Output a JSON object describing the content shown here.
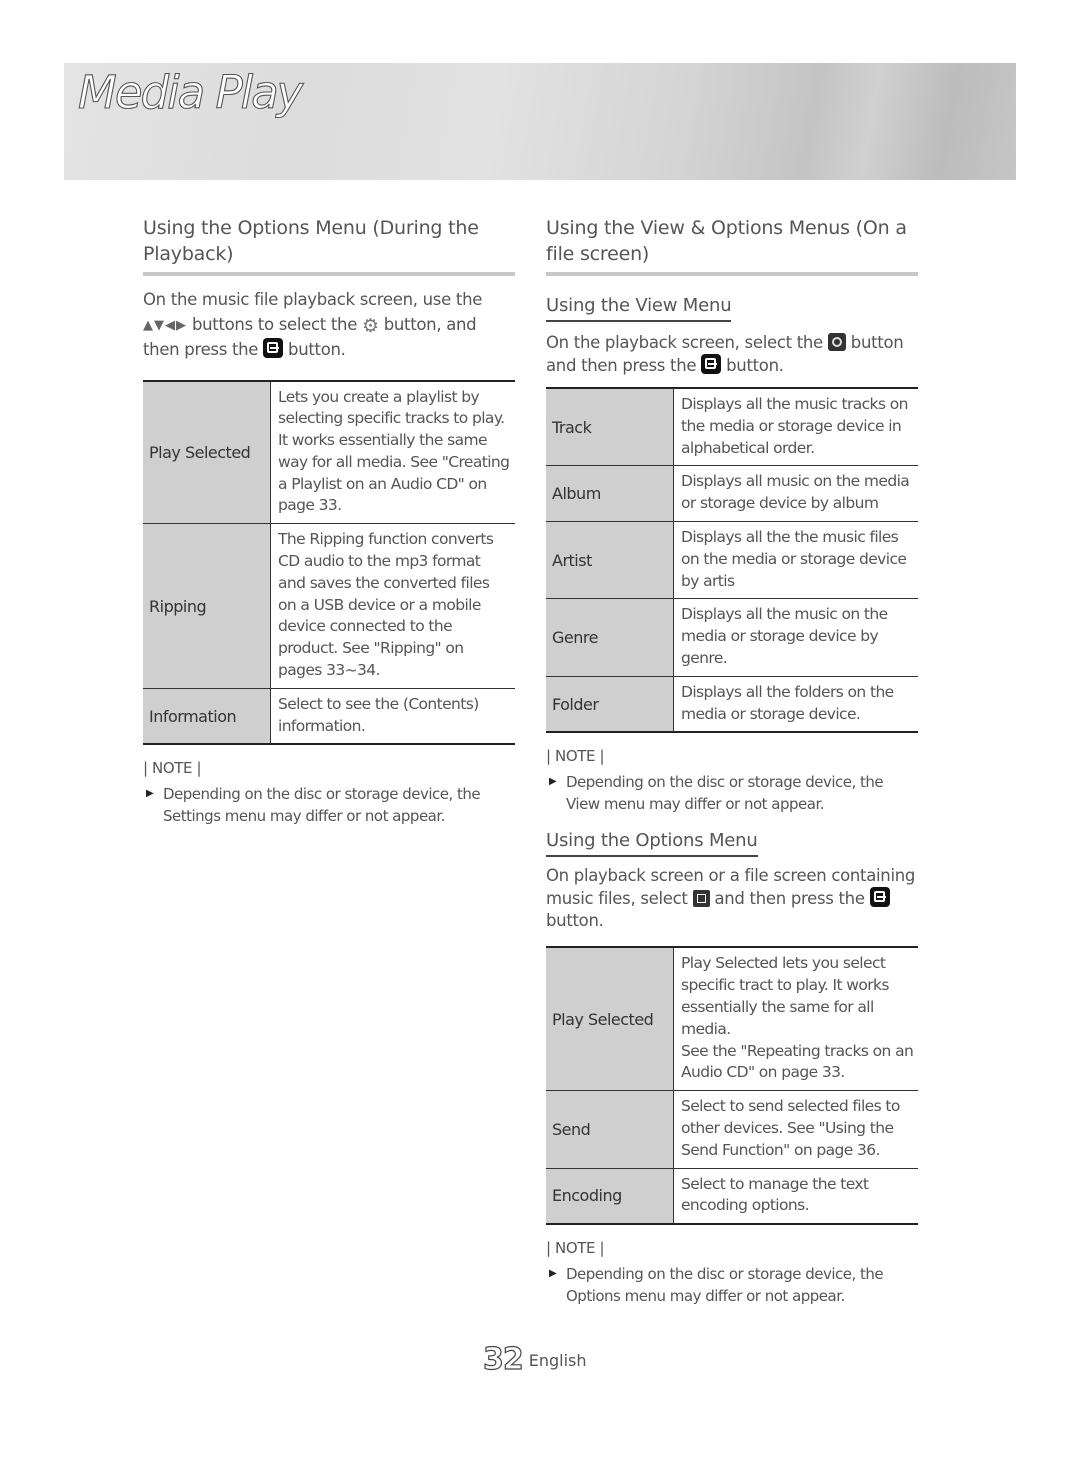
{
  "chapter_title": "Media Play",
  "left": {
    "heading": "Using the Options Menu (During the Playback)",
    "intro": {
      "line1": "On the music file playback screen, use the",
      "arrows": "▲▼◀▶",
      "part2": " buttons to select the ",
      "part3": " button, and",
      "part4": "then press the ",
      "part5": " button."
    },
    "table": [
      {
        "name": "Play Selected",
        "desc": "Lets you create a playlist by selecting specific tracks to play. It works essentially the same way for all media. See \"Creating a Playlist on an Audio CD\" on page 33."
      },
      {
        "name": "Ripping",
        "desc": "The Ripping function converts CD audio to the mp3 format and saves the converted files on a USB device or a mobile device connected to the product. See \"Ripping\" on pages 33~34."
      },
      {
        "name": "Information",
        "desc": "Select to see the (Contents) information."
      }
    ],
    "note_label": "| NOTE |",
    "note": "Depending on the disc or storage device, the Settings menu may differ or not appear."
  },
  "right": {
    "heading": "Using the View & Options Menus (On a file screen)",
    "view": {
      "heading": "Using the View Menu",
      "p1": "On the playback screen, select the ",
      "p2": " button and then press the ",
      "p3": " button.",
      "table": [
        {
          "name": "Track",
          "desc": "Displays all the music tracks on the media or storage device in alphabetical order."
        },
        {
          "name": "Album",
          "desc": "Displays all music on the media or storage device by album"
        },
        {
          "name": "Artist",
          "desc": "Displays all the the music files on the media or storage device by artis"
        },
        {
          "name": "Genre",
          "desc": "Displays all the music on the media or storage device by genre."
        },
        {
          "name": "Folder",
          "desc": "Displays all the folders on the media or storage device."
        }
      ],
      "note_label": "| NOTE |",
      "note": "Depending on the disc or storage device, the View menu may differ or not appear."
    },
    "options": {
      "heading": "Using the Options Menu",
      "p1": "On playback screen or a file screen containing music files, select ",
      "p2": " and then press the ",
      "p3": " button.",
      "table": [
        {
          "name": "Play Selected",
          "desc": "Play Selected lets you select specific tract to play. It works essentially the same for all media.",
          "desc2": "See the \"Repeating tracks on an Audio CD\" on page 33."
        },
        {
          "name": "Send",
          "desc": "Select to send selected files to other devices. See \"Using the Send Function\" on page 36."
        },
        {
          "name": "Encoding",
          "desc": "Select to manage the text encoding options."
        }
      ],
      "note_label": "| NOTE |",
      "note": "Depending on the disc or storage device, the Options menu may differ or not appear."
    }
  },
  "footer": {
    "page_number": "32",
    "language": "English"
  },
  "icons": {
    "bullet": "▶",
    "gear": "⚙"
  }
}
